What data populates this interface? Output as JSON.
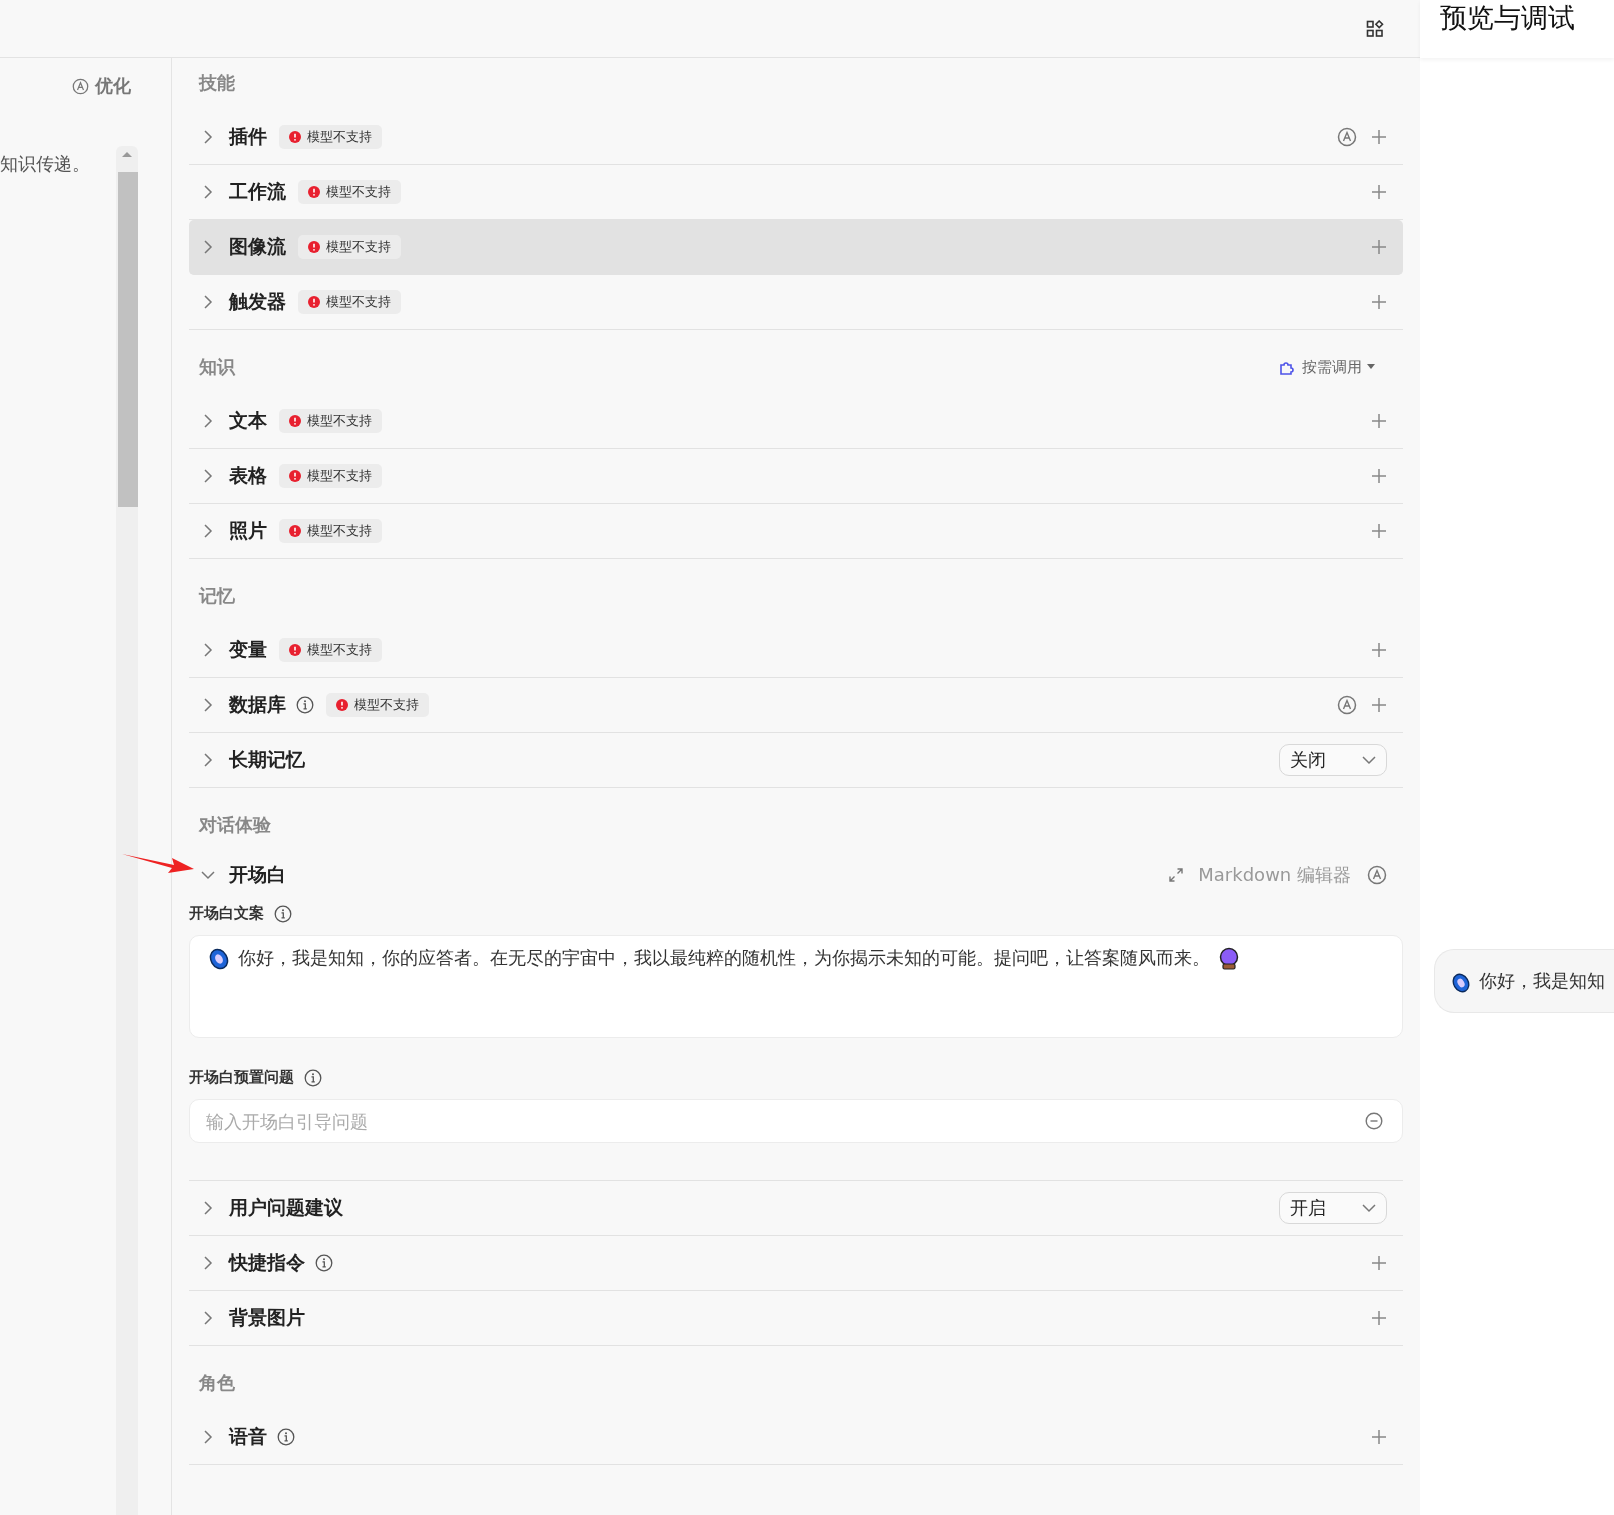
{
  "left_panel": {
    "optimize_label": "优化",
    "text": "知识传递。"
  },
  "sections": [
    {
      "title": "技能",
      "items": [
        {
          "kind": "row",
          "label": "插件",
          "info": false,
          "badge": "模型不支持",
          "auto": true,
          "control": {
            "kind": "add"
          },
          "expanded": false,
          "highlighted": false
        },
        {
          "kind": "row",
          "label": "工作流",
          "info": false,
          "badge": "模型不支持",
          "auto": false,
          "control": {
            "kind": "add"
          },
          "expanded": false,
          "highlighted": false
        },
        {
          "kind": "row",
          "label": "图像流",
          "info": false,
          "badge": "模型不支持",
          "auto": false,
          "control": {
            "kind": "add"
          },
          "expanded": false,
          "highlighted": true
        },
        {
          "kind": "row",
          "label": "触发器",
          "info": false,
          "badge": "模型不支持",
          "auto": false,
          "control": {
            "kind": "add"
          },
          "expanded": false,
          "highlighted": false
        }
      ]
    },
    {
      "title": "知识",
      "extra": "按需调用",
      "items": [
        {
          "kind": "row",
          "label": "文本",
          "info": false,
          "badge": "模型不支持",
          "auto": false,
          "control": {
            "kind": "add"
          },
          "expanded": false,
          "highlighted": false
        },
        {
          "kind": "row",
          "label": "表格",
          "info": false,
          "badge": "模型不支持",
          "auto": false,
          "control": {
            "kind": "add"
          },
          "expanded": false,
          "highlighted": false
        },
        {
          "kind": "row",
          "label": "照片",
          "info": false,
          "badge": "模型不支持",
          "auto": false,
          "control": {
            "kind": "add"
          },
          "expanded": false,
          "highlighted": false
        }
      ]
    },
    {
      "title": "记忆",
      "items": [
        {
          "kind": "row",
          "label": "变量",
          "info": false,
          "badge": "模型不支持",
          "auto": false,
          "control": {
            "kind": "add"
          },
          "expanded": false,
          "highlighted": false
        },
        {
          "kind": "row",
          "label": "数据库",
          "info": true,
          "badge": "模型不支持",
          "auto": true,
          "control": {
            "kind": "add"
          },
          "expanded": false,
          "highlighted": false
        },
        {
          "kind": "row",
          "label": "长期记忆",
          "info": false,
          "auto": false,
          "control": {
            "kind": "select",
            "value": "关闭"
          },
          "expanded": false,
          "highlighted": false
        }
      ]
    },
    {
      "title": "对话体验",
      "items": [
        {
          "kind": "opening",
          "label": "开场白",
          "info": false,
          "auto": true,
          "expanded": true,
          "highlighted": false,
          "editor_label": "Markdown 编辑器",
          "copy": {
            "label": "开场白文案",
            "value": "你好，我是知知，你的应答者。在无尽的宇宙中，我以最纯粹的随机性，为你揭示未知的可能。提问吧，让答案随风而来。"
          },
          "questions": {
            "label": "开场白预置问题",
            "placeholder": "输入开场白引导问题"
          }
        },
        {
          "kind": "row",
          "label": "用户问题建议",
          "info": false,
          "auto": false,
          "control": {
            "kind": "select",
            "value": "开启"
          },
          "expanded": false,
          "highlighted": false
        },
        {
          "kind": "row",
          "label": "快捷指令",
          "info": true,
          "auto": false,
          "control": {
            "kind": "add"
          },
          "expanded": false,
          "highlighted": false
        },
        {
          "kind": "row",
          "label": "背景图片",
          "info": false,
          "auto": false,
          "control": {
            "kind": "add"
          },
          "expanded": false,
          "highlighted": false
        }
      ]
    },
    {
      "title": "角色",
      "items": [
        {
          "kind": "row",
          "label": "语音",
          "info": true,
          "auto": false,
          "control": {
            "kind": "add"
          },
          "expanded": false,
          "highlighted": false
        }
      ]
    }
  ],
  "preview": {
    "title": "预览与调试",
    "bubble": "你好，我是知知"
  }
}
